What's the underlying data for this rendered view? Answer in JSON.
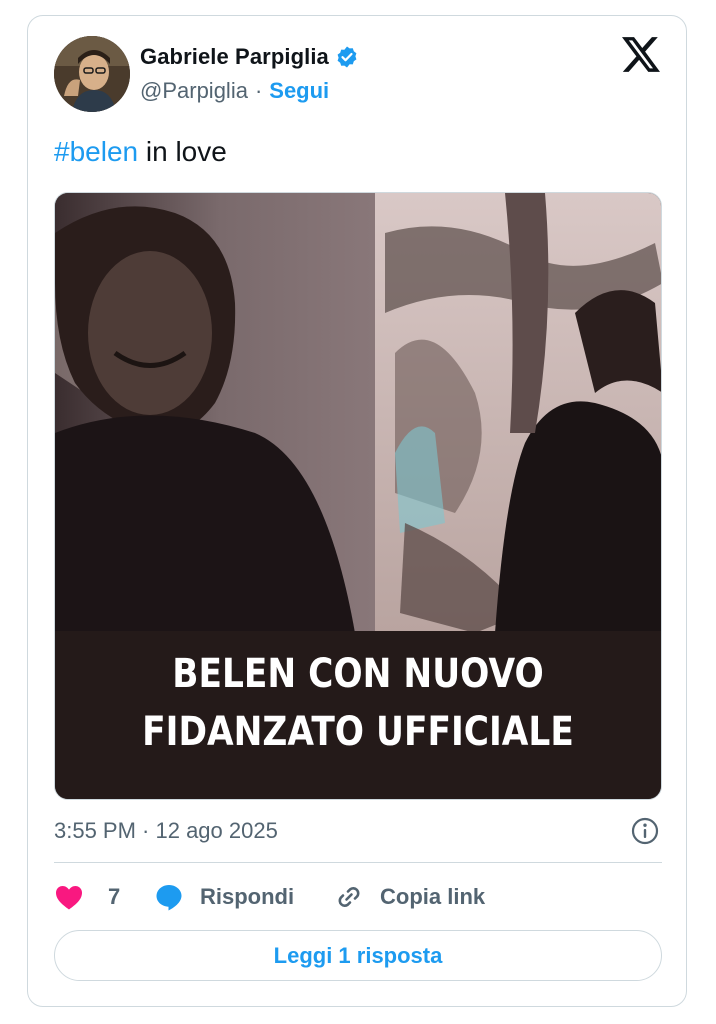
{
  "author": {
    "name": "Gabriele Parpiglia",
    "handle": "@Parpiglia",
    "separator": "·",
    "follow_label": "Segui",
    "verified": true
  },
  "brand_icon": "x-logo-icon",
  "tweet": {
    "hashtag": "#belen",
    "text_rest": " in love"
  },
  "media": {
    "caption_line1": "BELEN CON NUOVO",
    "caption_line2": "FIDANZATO UFFICIALE"
  },
  "meta": {
    "timestamp": "3:55 PM · 12 ago 2025",
    "info_icon": "info-icon"
  },
  "actions": {
    "like_count": "7",
    "reply_label": "Rispondi",
    "copy_label": "Copia link"
  },
  "read_more_label": "Leggi 1 risposta",
  "colors": {
    "accent": "#1d9bf0",
    "like": "#f91880",
    "muted": "#536471",
    "border": "#cfd9de"
  }
}
